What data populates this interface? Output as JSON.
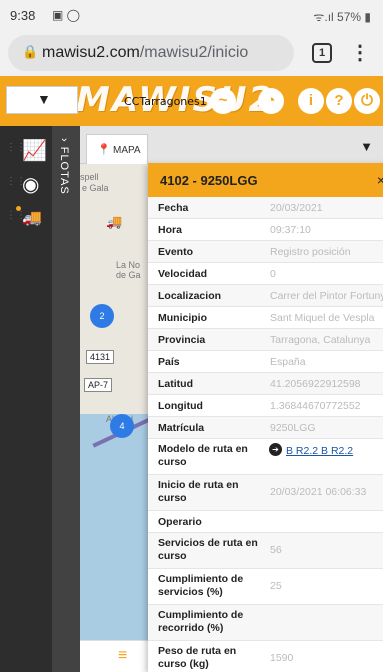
{
  "status_bar": {
    "time": "9:38",
    "icons": "▣ ◯",
    "signal_battery": "ᯤ.ıl 57% ▮"
  },
  "browser": {
    "url_host": "mawisu2.com",
    "url_path": "/mawisu2/inicio",
    "tab_count": "1",
    "menu_icon": "more-vert-icon"
  },
  "header": {
    "logo_text": "MAWISU2",
    "fleet_label": "CCTarragones1",
    "icons": [
      "pulse-icon",
      "gauge-icon",
      "info-icon",
      "help-icon",
      "power-icon"
    ],
    "icon_glyphs": [
      "~",
      "◔",
      "i",
      "?",
      "⏻"
    ]
  },
  "rail": {
    "items": [
      "chart-icon",
      "gauge-icon",
      "truck-icon"
    ],
    "glyphs": [
      "📈",
      "◉",
      "🚚"
    ]
  },
  "flotas_label": "› FLOTAS",
  "map": {
    "tab_label": "MAPA",
    "labels": [
      "spell",
      "e Gala",
      "La No",
      "de Ga",
      "Alcaful",
      "4131",
      "AP-7"
    ],
    "clusters": [
      "2",
      "4"
    ]
  },
  "popup": {
    "title": "4102 - 9250LGG",
    "close": "×",
    "rows": [
      {
        "k": "Fecha",
        "v": "20/03/2021"
      },
      {
        "k": "Hora",
        "v": "09:37:10"
      },
      {
        "k": "Evento",
        "v": "Registro posición"
      },
      {
        "k": "Velocidad",
        "v": "0"
      },
      {
        "k": "Localizacion",
        "v": "Carrer del Pintor Fortuny"
      },
      {
        "k": "Municipio",
        "v": "Sant Miquel de Vespla"
      },
      {
        "k": "Provincia",
        "v": "Tarragona, Catalunya"
      },
      {
        "k": "País",
        "v": "España"
      },
      {
        "k": "Latitud",
        "v": "41.2056922912598"
      },
      {
        "k": "Longitud",
        "v": "1.36844670772552"
      },
      {
        "k": "Matrícula",
        "v": "9250LGG"
      },
      {
        "k": "Modelo de ruta en curso",
        "v": "B R2.2 B R2.2"
      },
      {
        "k": "Inicio de ruta en curso",
        "v": "20/03/2021 06:06:33"
      },
      {
        "k": "Operario",
        "v": ""
      },
      {
        "k": "Servicios de ruta en curso",
        "v": "56"
      },
      {
        "k": "Cumplimiento de servicios (%)",
        "v": "25"
      },
      {
        "k": "Cumplimiento de recorrido (%)",
        "v": ""
      },
      {
        "k": "Peso de ruta en curso (kg)",
        "v": "1590"
      }
    ]
  },
  "bottom": {
    "menu_icon": "hamburger-icon",
    "glyph": "≡"
  }
}
